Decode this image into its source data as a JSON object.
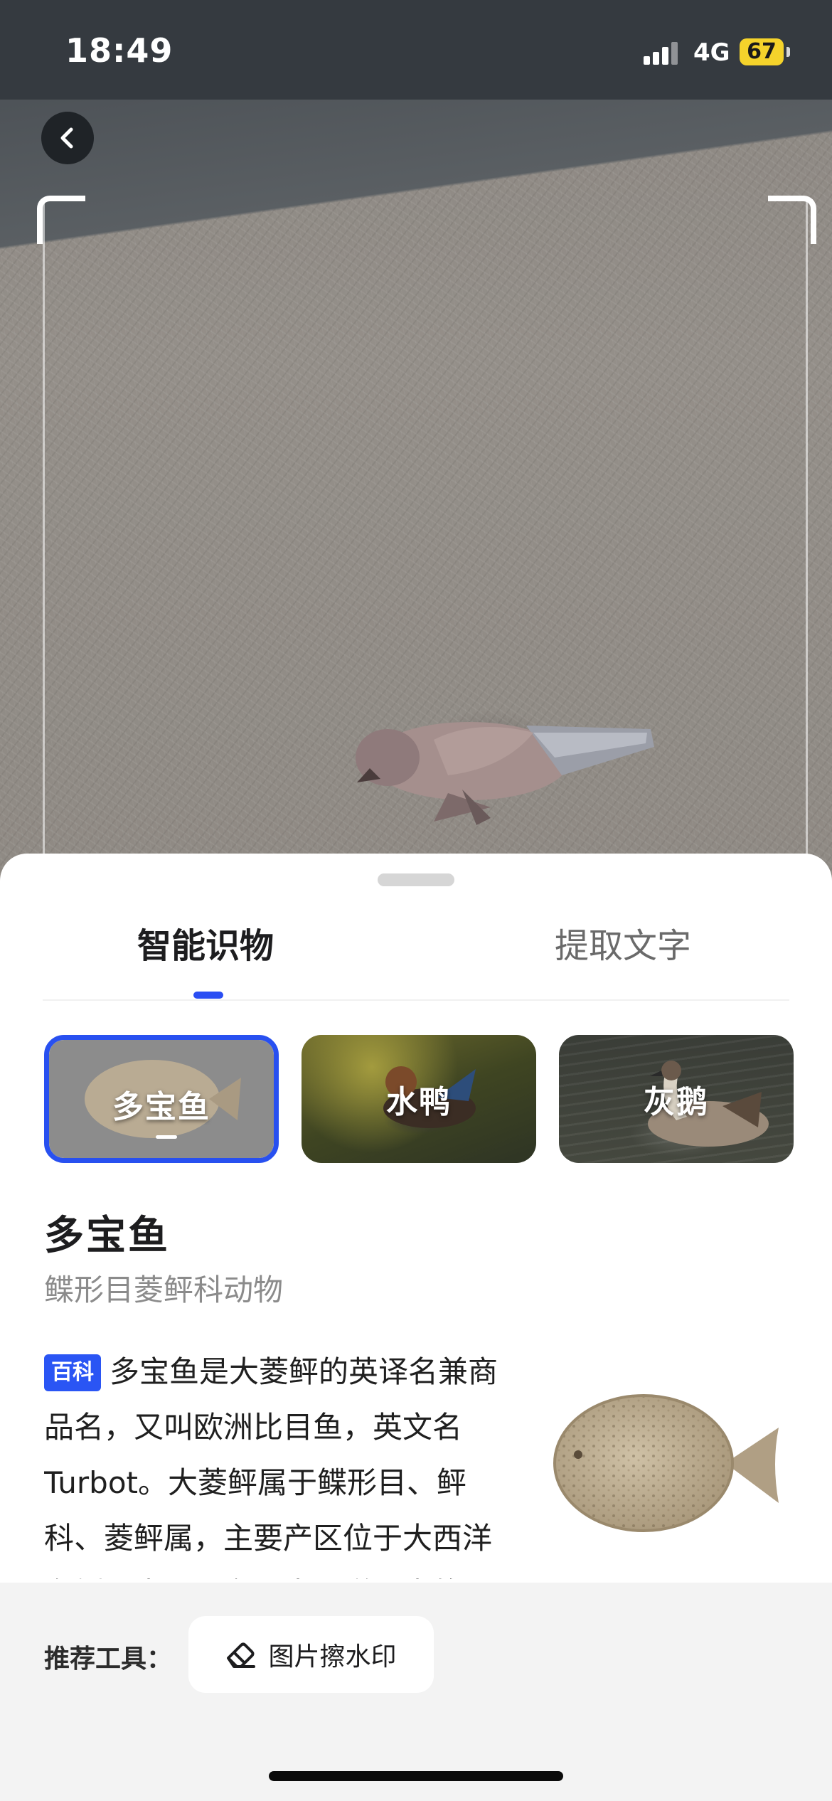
{
  "status_bar": {
    "time": "18:49",
    "network": "4G",
    "battery": "67"
  },
  "navigation": {
    "back_icon": "chevron-left-icon"
  },
  "tabs": [
    {
      "label": "智能识物",
      "active": true
    },
    {
      "label": "提取文字",
      "active": false
    }
  ],
  "results": [
    {
      "label": "多宝鱼",
      "selected": true
    },
    {
      "label": "水鸭",
      "selected": false
    },
    {
      "label": "灰鹅",
      "selected": false
    }
  ],
  "detail": {
    "title": "多宝鱼",
    "subtitle": "鲽形目菱鲆科动物",
    "badge": "百科",
    "description": "多宝鱼是大菱鲆的英译名兼商品名，又叫欧洲比目鱼，英文名Turbot。大菱鲆属于鲽形目、鲆科、菱鲆属，主要产区位于大西洋东侧沿岸，是东北大西洋沿岸的"
  },
  "tools": {
    "label": "推荐工具：",
    "button": "图片擦水印",
    "button_icon": "eraser-icon"
  },
  "colors": {
    "accent": "#2a4ef3",
    "battery": "#f5d32b"
  }
}
